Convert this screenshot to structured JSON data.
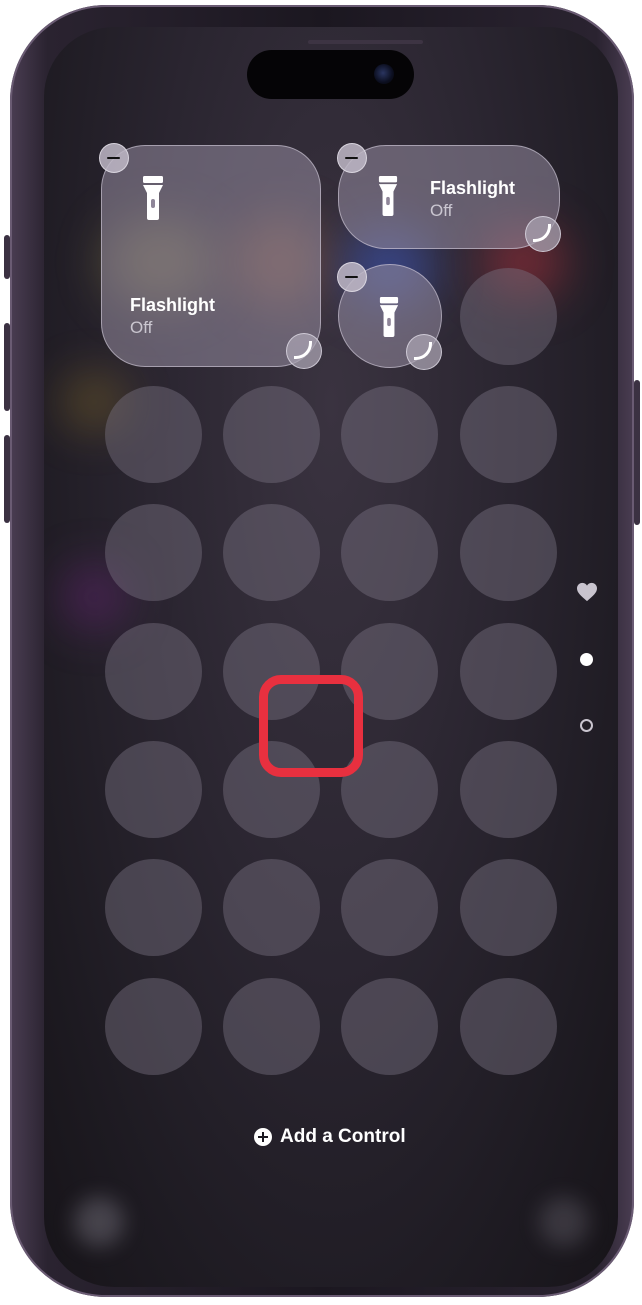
{
  "colors": {
    "highlight": "#e8303f",
    "tile_bg": "#968ca0",
    "text_primary": "#ffffff"
  },
  "controls": {
    "large_tile": {
      "title": "Flashlight",
      "state": "Off",
      "icon": "flashlight-icon"
    },
    "medium_tile": {
      "title": "Flashlight",
      "state": "Off",
      "icon": "flashlight-icon"
    },
    "small_tile": {
      "icon": "flashlight-icon"
    }
  },
  "page_indicators": [
    {
      "icon": "heart-icon"
    },
    {
      "icon": "filled-dot",
      "active": true
    },
    {
      "icon": "outline-dot",
      "active": false
    }
  ],
  "add_control": {
    "label": "Add a Control",
    "icon": "plus-circle-icon"
  }
}
